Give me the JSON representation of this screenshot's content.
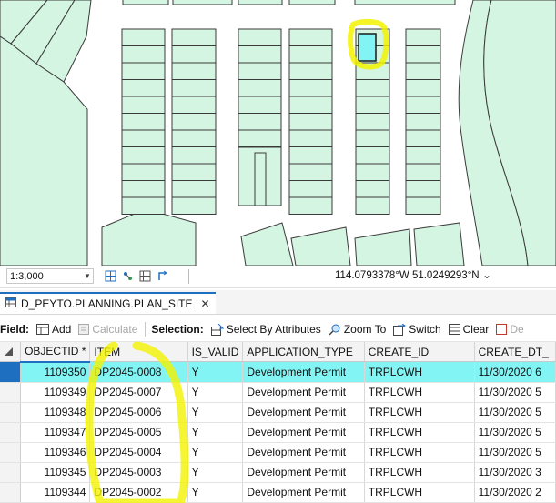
{
  "status_bar": {
    "scale": "1:3,000",
    "coordinates": "114.0793378°W 51.0249293°N"
  },
  "table_tab": {
    "title": "D_PEYTO.PLANNING.PLAN_SITE",
    "close_icon": "close-icon"
  },
  "toolbar": {
    "field_label": "Field:",
    "add": "Add",
    "calculate": "Calculate",
    "selection_label": "Selection:",
    "select_by_attributes": "Select By Attributes",
    "zoom_to": "Zoom To",
    "switch": "Switch",
    "clear": "Clear",
    "delete": "De"
  },
  "table": {
    "columns": [
      "OBJECTID *",
      "ITEM",
      "IS_VALID",
      "APPLICATION_TYPE",
      "CREATE_ID",
      "CREATE_DT_"
    ],
    "rows": [
      {
        "objectid": "1109350",
        "item": "DP2045-0008",
        "is_valid": "Y",
        "application_type": "Development Permit",
        "create_id": "TRPLCWH",
        "create_dt": "11/30/2020 6",
        "selected": true
      },
      {
        "objectid": "1109349",
        "item": "DP2045-0007",
        "is_valid": "Y",
        "application_type": "Development Permit",
        "create_id": "TRPLCWH",
        "create_dt": "11/30/2020 5",
        "selected": false
      },
      {
        "objectid": "1109348",
        "item": "DP2045-0006",
        "is_valid": "Y",
        "application_type": "Development Permit",
        "create_id": "TRPLCWH",
        "create_dt": "11/30/2020 5",
        "selected": false
      },
      {
        "objectid": "1109347",
        "item": "DP2045-0005",
        "is_valid": "Y",
        "application_type": "Development Permit",
        "create_id": "TRPLCWH",
        "create_dt": "11/30/2020 5",
        "selected": false
      },
      {
        "objectid": "1109346",
        "item": "DP2045-0004",
        "is_valid": "Y",
        "application_type": "Development Permit",
        "create_id": "TRPLCWH",
        "create_dt": "11/30/2020 5",
        "selected": false
      },
      {
        "objectid": "1109345",
        "item": "DP2045-0003",
        "is_valid": "Y",
        "application_type": "Development Permit",
        "create_id": "TRPLCWH",
        "create_dt": "11/30/2020 3",
        "selected": false
      },
      {
        "objectid": "1109344",
        "item": "DP2045-0002",
        "is_valid": "Y",
        "application_type": "Development Permit",
        "create_id": "TRPLCWH",
        "create_dt": "11/30/2020 2",
        "selected": false
      }
    ]
  },
  "colors": {
    "parcel_fill": "#d5f5e3",
    "parcel_stroke": "#3a3a3a",
    "selection_highlight": "#82f4f4",
    "annotation_yellow": "#f2f200",
    "accent_blue": "#1f6fc0"
  }
}
